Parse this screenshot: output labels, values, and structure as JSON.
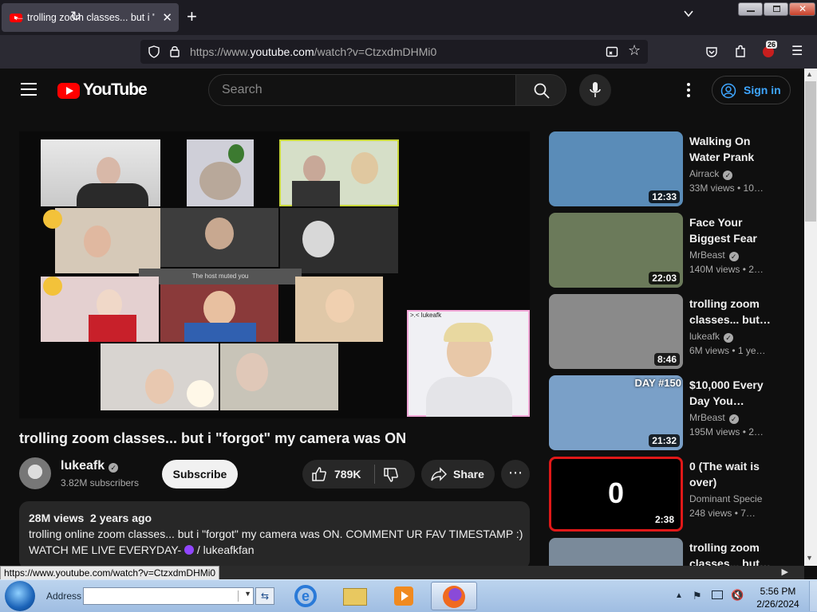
{
  "browser": {
    "tab_title": "trolling zoom classes... but i \"forgot\" my camera was ON",
    "url_prefix": "https://www.",
    "url_domain": "youtube.com",
    "url_path": "/watch?v=CtzxdmDHMi0",
    "extension_badge": "26",
    "status_url": "https://www.youtube.com/watch?v=CtzxdmDHMi0"
  },
  "youtube": {
    "logo_text": "YouTube",
    "search_placeholder": "Search",
    "sign_in": "Sign in"
  },
  "video": {
    "title": "trolling zoom classes... but i \"forgot\" my camera was ON",
    "channel": "lukeafk",
    "subscribers": "3.82M subscribers",
    "subscribe_label": "Subscribe",
    "likes": "789K",
    "share_label": "Share",
    "views": "28M views",
    "age": "2 years ago",
    "desc_line1": "trolling online zoom classes... but i \"forgot\" my camera was ON. COMMENT UR FAV TIMESTAMP :)",
    "desc_line2_prefix": "WATCH ME LIVE EVERYDAY-",
    "desc_line2_link": "/ lukeafkfan",
    "player_caption": "The host muted you",
    "cam_label": ">.< lukeafk"
  },
  "recommendations": [
    {
      "title": "Walking On Water Prank",
      "channel": "Airrack",
      "meta": "33M views  • 10…",
      "duration": "12:33",
      "thumb_color": "#5a8cb8"
    },
    {
      "title": "Face Your Biggest Fear T…",
      "channel": "MrBeast",
      "meta": "140M views  • 2…",
      "duration": "22:03",
      "thumb_color": "#6b7a5a"
    },
    {
      "title": "trolling zoom classes... but…",
      "channel": "lukeafk",
      "meta": "6M views  • 1 ye…",
      "duration": "8:46",
      "thumb_color": "#8a8a8a"
    },
    {
      "title": "$10,000 Every Day You…",
      "channel": "MrBeast",
      "meta": "195M views  • 2…",
      "duration": "21:32",
      "thumb_color": "#7aa0c8",
      "badge": "DAY #150"
    },
    {
      "title": "0 (The wait is over)",
      "channel": "Dominant Specie",
      "meta": "248 views  • 7…",
      "duration": "2:38",
      "thumb_color": "#000000",
      "thumb_text": "0"
    },
    {
      "title": "trolling zoom classes... but…",
      "channel": "",
      "meta": "",
      "duration": "",
      "thumb_color": "#7a8a9a"
    }
  ],
  "taskbar": {
    "address_label": "Address",
    "time": "5:56 PM",
    "date": "2/26/2024"
  }
}
